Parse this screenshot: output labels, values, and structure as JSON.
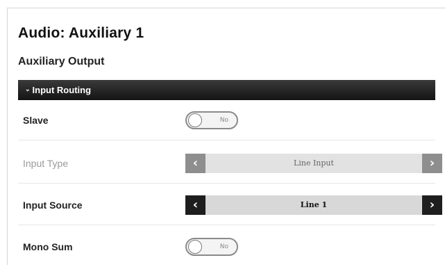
{
  "page": {
    "title": "Audio: Auxiliary 1",
    "subtitle": "Auxiliary Output"
  },
  "section": {
    "label": "Input Routing",
    "chevron": "chevron-down-icon",
    "expanded": true
  },
  "rows": {
    "slave": {
      "label": "Slave",
      "value": "No"
    },
    "input_type": {
      "label": "Input Type",
      "value": "Line Input",
      "disabled": true
    },
    "input_source": {
      "label": "Input Source",
      "value": "Line 1"
    },
    "mono_sum": {
      "label": "Mono Sum",
      "value": "No"
    }
  },
  "icons": {
    "prev": "‹",
    "next": "›",
    "chevron_down": "⌄"
  },
  "colors": {
    "header_bar": "#1a1a1a",
    "arrow_enabled": "#1e1e1e",
    "arrow_disabled": "#8e8e8e"
  }
}
